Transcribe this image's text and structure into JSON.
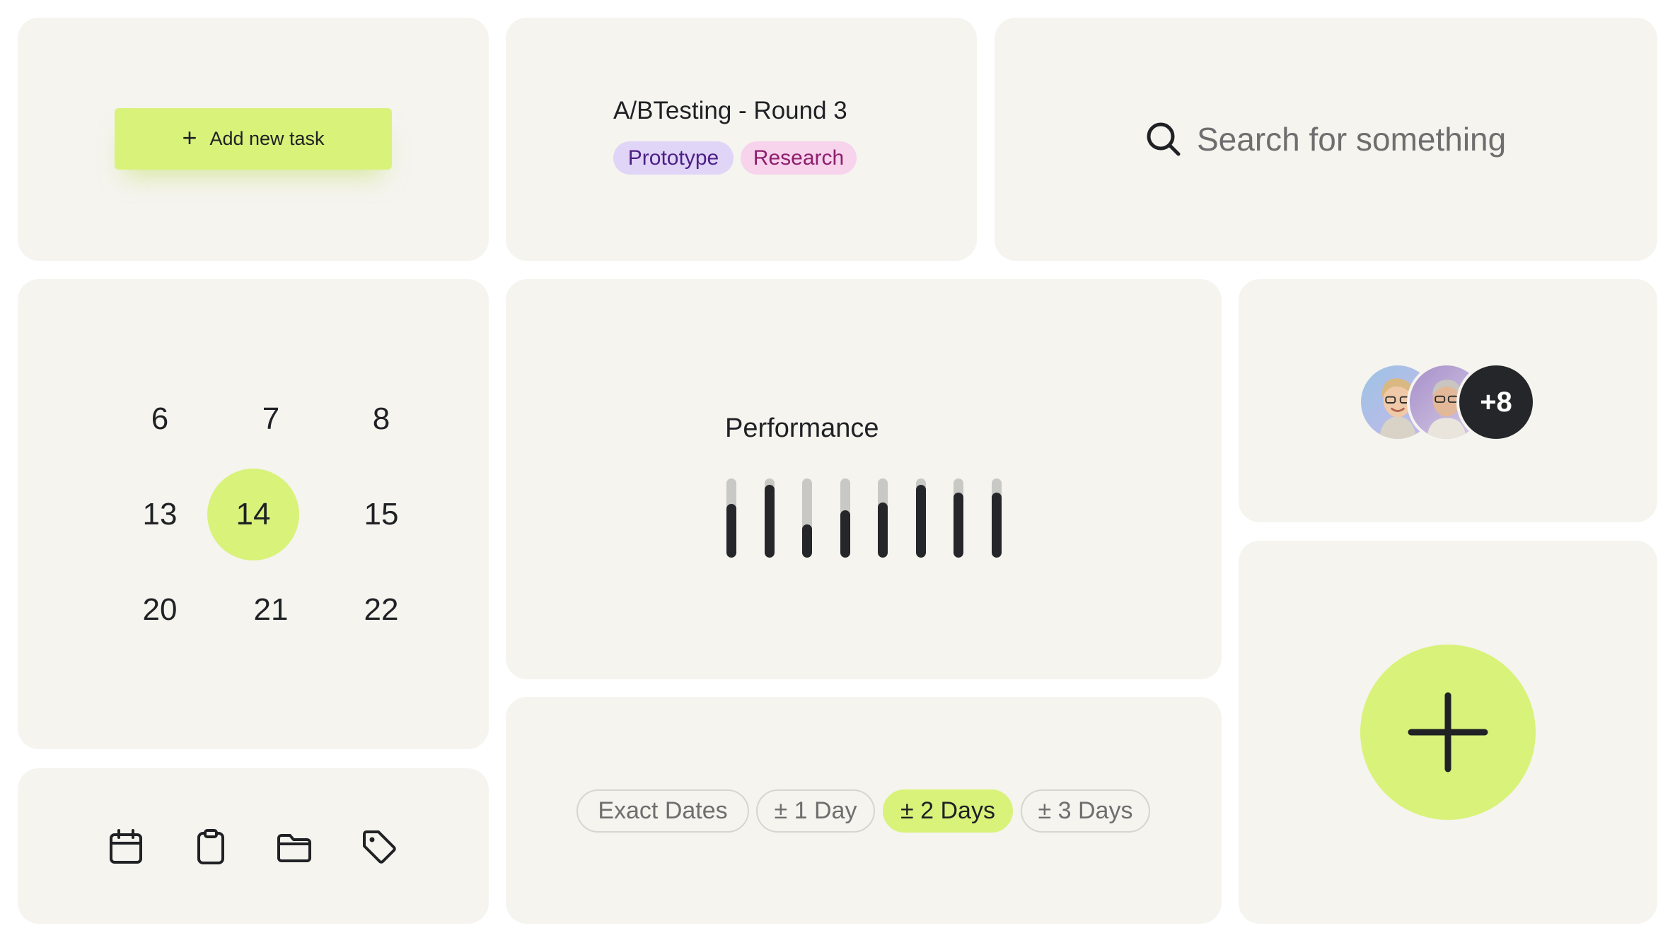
{
  "add_task": {
    "icon": "plus-icon",
    "label": "Add new task",
    "accent": "#d9f27a"
  },
  "project": {
    "title": "A/BTesting - Round 3",
    "tags": [
      {
        "label": "Prototype",
        "bg": "#e0d4f7",
        "color": "#4d1f86"
      },
      {
        "label": "Research",
        "bg": "#f7d3ec",
        "color": "#8e1f6e"
      }
    ]
  },
  "search": {
    "icon": "search-icon",
    "placeholder": "Search for something"
  },
  "calendar": {
    "days": [
      "6",
      "7",
      "8",
      "13",
      "14",
      "15",
      "20",
      "21",
      "22"
    ],
    "selected": "14"
  },
  "tools": {
    "icons": [
      "calendar-icon",
      "clipboard-icon",
      "folder-icon",
      "tag-icon"
    ]
  },
  "performance": {
    "title": "Performance",
    "levels": [
      0.68,
      0.92,
      0.42,
      0.6,
      0.7,
      0.92,
      0.82,
      0.82
    ]
  },
  "team": {
    "more_label": "+8",
    "avatar_count": 2
  },
  "date_filters": {
    "options": [
      "Exact Dates",
      "± 1 Day",
      "± 2 Days",
      "± 3 Days"
    ],
    "selected": "± 2 Days"
  },
  "fab": {
    "icon": "plus-icon"
  },
  "colors": {
    "card": "#f5f4ef",
    "accent": "#d9f27a",
    "dark": "#24262a",
    "bar_track": "#c8c8c4"
  }
}
